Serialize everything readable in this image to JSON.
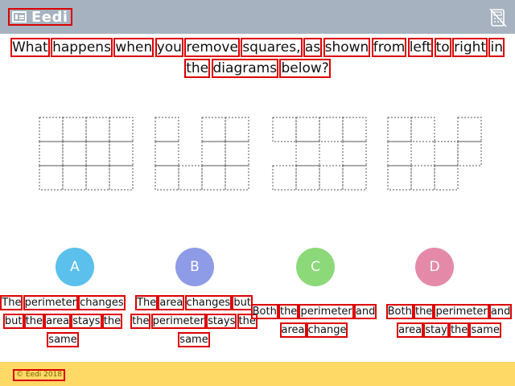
{
  "brand": {
    "name": "Eedi"
  },
  "question": {
    "line1": [
      "What",
      "happens",
      "when",
      "you",
      "remove",
      "squares,",
      "as",
      "shown",
      "from",
      "left",
      "to",
      "right",
      "in"
    ],
    "line2": [
      "the",
      "diagrams",
      "below?"
    ]
  },
  "options": [
    {
      "letter": "A",
      "color": "#5bc0eb",
      "lines": [
        "The perimeter changes",
        "but the area stays the",
        "same"
      ]
    },
    {
      "letter": "B",
      "color": "#8e9be6",
      "lines": [
        "The area changes but",
        "the perimeter stays the",
        "same"
      ]
    },
    {
      "letter": "C",
      "color": "#8cd97a",
      "lines": [
        "Both the perimeter and",
        "area change"
      ]
    },
    {
      "letter": "D",
      "color": "#e48aa8",
      "lines": [
        "Both the perimeter and",
        "area stay the same"
      ]
    }
  ],
  "footer": {
    "copyright": "© Eedi 2018"
  },
  "icons": {
    "brand": "eedi-logo-icon",
    "top_right": "calculator-disabled-icon"
  }
}
